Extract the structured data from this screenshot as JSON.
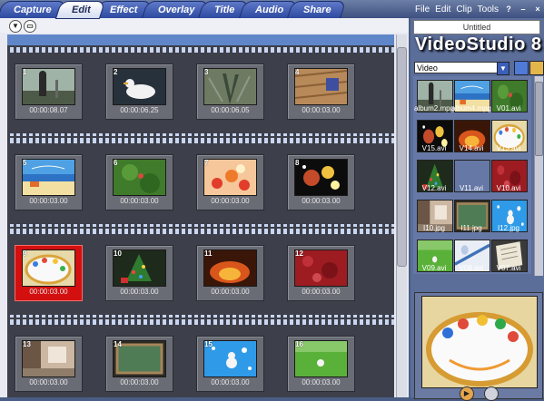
{
  "tabs": [
    "Capture",
    "Edit",
    "Effect",
    "Overlay",
    "Title",
    "Audio",
    "Share"
  ],
  "active_tab": "Edit",
  "menu": [
    "File",
    "Edit",
    "Clip",
    "Tools"
  ],
  "window_controls": [
    "?",
    "–",
    "×"
  ],
  "project_title": "Untitled",
  "brand": "VideoStudio 8",
  "library": {
    "category": "Video",
    "items": [
      {
        "label": "album2.mpg",
        "icon": "statue-thumbnail"
      },
      {
        "label": "album4.mpg",
        "icon": "beach-thumbnail"
      },
      {
        "label": "V01.avi",
        "icon": "green-thumbnail"
      },
      {
        "label": "V15.avi",
        "icon": "sparkle-thumbnail"
      },
      {
        "label": "V14.avi",
        "icon": "fire-thumbnail"
      },
      {
        "label": "V13.avi",
        "icon": "cake-thumbnail"
      },
      {
        "label": "V12.avi",
        "icon": "tree-thumbnail"
      },
      {
        "label": "V11.avi",
        "icon": "orange-thumbnail"
      },
      {
        "label": "V10.avi",
        "icon": "red-thumbnail"
      },
      {
        "label": "I10.jpg",
        "icon": "room-thumbnail"
      },
      {
        "label": "I11.jpg",
        "icon": "board-thumbnail"
      },
      {
        "label": "I12.jpg",
        "icon": "bubbles-thumbnail"
      },
      {
        "label": "V09.avi",
        "icon": "field-thumbnail"
      },
      {
        "label": "V08.avi",
        "icon": "sky-thumbnail"
      },
      {
        "label": "V07.avi",
        "icon": "paper-thumbnail"
      }
    ]
  },
  "clips": [
    {
      "number": "1",
      "duration": "00:00:08.07",
      "selected": false,
      "icon": "statue-thumbnail"
    },
    {
      "number": "2",
      "duration": "00:00:06.25",
      "selected": false,
      "icon": "duck-thumbnail"
    },
    {
      "number": "3",
      "duration": "00:00:06.05",
      "selected": false,
      "icon": "peacock-thumbnail"
    },
    {
      "number": "4",
      "duration": "00:00:03.00",
      "selected": false,
      "icon": "wood-thumbnail"
    },
    {
      "number": "5",
      "duration": "00:00:03.00",
      "selected": false,
      "icon": "beach-thumbnail"
    },
    {
      "number": "6",
      "duration": "00:00:03.00",
      "selected": false,
      "icon": "green-thumbnail"
    },
    {
      "number": "7",
      "duration": "00:00:03.00",
      "selected": false,
      "icon": "flowers-thumbnail"
    },
    {
      "number": "8",
      "duration": "00:00:03.00",
      "selected": false,
      "icon": "sparkle-thumbnail"
    },
    {
      "number": "9",
      "duration": "00:00:03.00",
      "selected": true,
      "icon": "cake-thumbnail"
    },
    {
      "number": "10",
      "duration": "00:00:03.00",
      "selected": false,
      "icon": "tree-thumbnail"
    },
    {
      "number": "11",
      "duration": "00:00:03.00",
      "selected": false,
      "icon": "fire-thumbnail"
    },
    {
      "number": "12",
      "duration": "00:00:03.00",
      "selected": false,
      "icon": "red-thumbnail"
    },
    {
      "number": "13",
      "duration": "00:00:03.00",
      "selected": false,
      "icon": "room-thumbnail"
    },
    {
      "number": "14",
      "duration": "00:00:03.00",
      "selected": false,
      "icon": "board-thumbnail"
    },
    {
      "number": "15",
      "duration": "00:00:03.00",
      "selected": false,
      "icon": "bubbles-thumbnail"
    },
    {
      "number": "16",
      "duration": "00:00:03.00",
      "selected": false,
      "icon": "field-thumbnail"
    }
  ],
  "colors": {
    "accent_blue": "#5f86c9",
    "film_strip": "#3d3f4a",
    "selected_clip": "#d40f0f",
    "right_panel": "#5b6e9a"
  },
  "preview_icon": "cake-preview",
  "player_buttons": [
    "play-button",
    "stop-button"
  ]
}
